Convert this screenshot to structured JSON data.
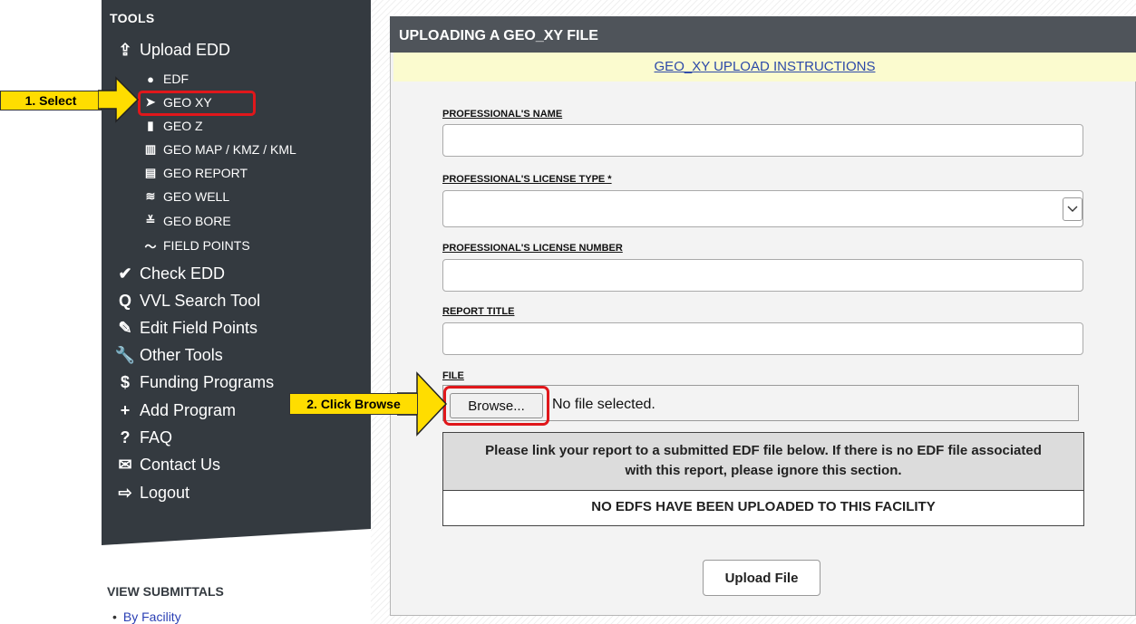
{
  "sidebar": {
    "tools_heading": "TOOLS",
    "items": [
      {
        "label": "Upload EDD",
        "icon": "upload-icon",
        "glyph": "⇪"
      },
      {
        "label": "EDF",
        "icon": "drop-icon",
        "glyph": "●"
      },
      {
        "label": "GEO XY",
        "icon": "location-arrow-icon",
        "glyph": "➤"
      },
      {
        "label": "GEO Z",
        "icon": "ruler-icon",
        "glyph": "▮"
      },
      {
        "label": "GEO MAP / KMZ / KML",
        "icon": "map-icon",
        "glyph": "▥"
      },
      {
        "label": "GEO REPORT",
        "icon": "document-icon",
        "glyph": "▤"
      },
      {
        "label": "GEO WELL",
        "icon": "well-icon",
        "glyph": "≋"
      },
      {
        "label": "GEO BORE",
        "icon": "double-chevron-down-icon",
        "glyph": "≚"
      },
      {
        "label": "FIELD POINTS",
        "icon": "squiggle-icon",
        "glyph": "〜"
      },
      {
        "label": "Check EDD",
        "icon": "check-icon",
        "glyph": "✔"
      },
      {
        "label": "VVL Search Tool",
        "icon": "search-icon",
        "glyph": "Q"
      },
      {
        "label": "Edit Field Points",
        "icon": "edit-icon",
        "glyph": "✎"
      },
      {
        "label": "Other Tools",
        "icon": "wrench-icon",
        "glyph": "🔧"
      },
      {
        "label": "Funding Programs",
        "icon": "dollar-icon",
        "glyph": "$"
      },
      {
        "label": "Add Program",
        "icon": "plus-icon",
        "glyph": "+"
      },
      {
        "label": "FAQ",
        "icon": "question-icon",
        "glyph": "?"
      },
      {
        "label": "Contact Us",
        "icon": "envelope-icon",
        "glyph": "✉"
      },
      {
        "label": "Logout",
        "icon": "logout-icon",
        "glyph": "⇨"
      }
    ],
    "view_heading": "VIEW SUBMITTALS",
    "view_items": [
      {
        "label": "By Facility",
        "bullet": "•"
      }
    ]
  },
  "panel": {
    "title": "UPLOADING A GEO_XY FILE",
    "instructions_link": "GEO_XY UPLOAD INSTRUCTIONS",
    "fields": {
      "name_label": "PROFESSIONAL'S NAME",
      "name_value": "",
      "license_type_label": "PROFESSIONAL'S LICENSE TYPE *",
      "license_type_value": "",
      "license_number_label": "PROFESSIONAL'S LICENSE NUMBER",
      "license_number_value": "",
      "report_title_label": "REPORT TITLE",
      "report_title_value": "",
      "file_label": "FILE"
    },
    "browse_label": "Browse...",
    "file_status": "No file selected.",
    "edf_message": "Please link your report to a submitted EDF file below. If there is no EDF file associated with this report, please ignore this section.",
    "edf_none": "NO EDFS HAVE BEEN UPLOADED TO THIS FACILITY",
    "upload_label": "Upload File"
  },
  "annotations": {
    "step1": "1. Select",
    "step2": "2. Click Browse"
  },
  "colors": {
    "sidebar_bg": "#343a40",
    "panel_header_bg": "#4f545a",
    "highlight": "#e0171b",
    "callout_fill": "#ffdd00",
    "instructions_bg": "#fbfbcf"
  }
}
